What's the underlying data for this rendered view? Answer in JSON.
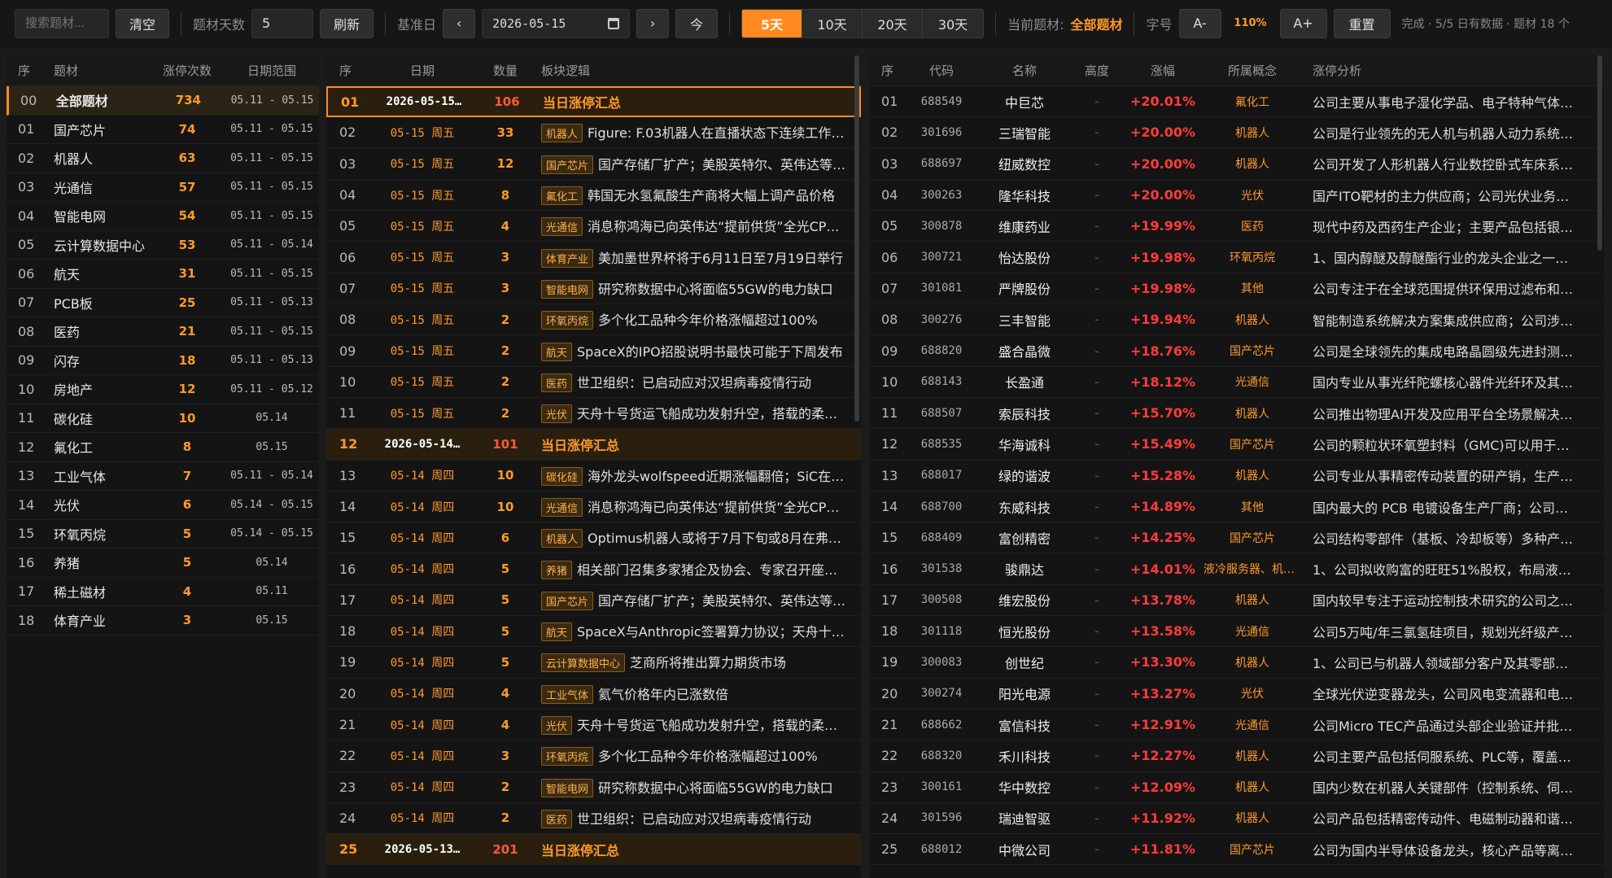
{
  "toolbar": {
    "search_placeholder": "搜索题材...",
    "clear_label": "清空",
    "days_label": "题材天数",
    "days_value": "5",
    "refresh_label": "刷新",
    "base_date_label": "基准日",
    "prev_label": "‹",
    "date_value": "2026-05-15",
    "next_label": "›",
    "today_label": "今",
    "ranges": [
      "5天",
      "10天",
      "20天",
      "30天"
    ],
    "current_topic_label": "当前题材:",
    "current_topic_value": "全部题材",
    "font_label": "字号",
    "font_dec": "A-",
    "font_zoom": "110%",
    "font_inc": "A+",
    "reset_label": "重置",
    "status": "完成 · 5/5 日有数据 · 题材 18 个"
  },
  "topics": {
    "headers": [
      "序",
      "题材",
      "涨停次数",
      "日期范围"
    ],
    "rows": [
      [
        "00",
        "全部题材",
        "734",
        "05.11 - 05.15"
      ],
      [
        "01",
        "国产芯片",
        "74",
        "05.11 - 05.15"
      ],
      [
        "02",
        "机器人",
        "63",
        "05.11 - 05.15"
      ],
      [
        "03",
        "光通信",
        "57",
        "05.11 - 05.15"
      ],
      [
        "04",
        "智能电网",
        "54",
        "05.11 - 05.15"
      ],
      [
        "05",
        "云计算数据中心",
        "53",
        "05.11 - 05.14"
      ],
      [
        "06",
        "航天",
        "31",
        "05.11 - 05.15"
      ],
      [
        "07",
        "PCB板",
        "25",
        "05.11 - 05.13"
      ],
      [
        "08",
        "医药",
        "21",
        "05.11 - 05.15"
      ],
      [
        "09",
        "闪存",
        "18",
        "05.11 - 05.13"
      ],
      [
        "10",
        "房地产",
        "12",
        "05.11 - 05.12"
      ],
      [
        "11",
        "碳化硅",
        "10",
        "05.14"
      ],
      [
        "12",
        "氟化工",
        "8",
        "05.15"
      ],
      [
        "13",
        "工业气体",
        "7",
        "05.11 - 05.14"
      ],
      [
        "14",
        "光伏",
        "6",
        "05.14 - 05.15"
      ],
      [
        "15",
        "环氧丙烷",
        "5",
        "05.14 - 05.15"
      ],
      [
        "16",
        "养猪",
        "5",
        "05.14"
      ],
      [
        "17",
        "稀土磁材",
        "4",
        "05.11"
      ],
      [
        "18",
        "体育产业",
        "3",
        "05.15"
      ]
    ]
  },
  "days": {
    "headers": [
      "序",
      "日期",
      "数量",
      "板块逻辑"
    ],
    "rows": [
      {
        "idx": "01",
        "date": "2026-05-15…",
        "count": "106",
        "tag": "",
        "logic": "当日涨停汇总",
        "sum": true
      },
      {
        "idx": "02",
        "date": "05-15 周五",
        "count": "33",
        "tag": "机器人",
        "logic": "Figure: F.03机器人在直播状态下连续工作超…"
      },
      {
        "idx": "03",
        "date": "05-15 周五",
        "count": "12",
        "tag": "国产芯片",
        "logic": "国产存储厂扩产；美股英特尔、英伟达等股…"
      },
      {
        "idx": "04",
        "date": "05-15 周五",
        "count": "8",
        "tag": "氟化工",
        "logic": "韩国无水氢氟酸生产商将大幅上调产品价格"
      },
      {
        "idx": "05",
        "date": "05-15 周五",
        "count": "4",
        "tag": "光通信",
        "logic": "消息称鸿海已向英伟达“提前供货”全光CPO…"
      },
      {
        "idx": "06",
        "date": "05-15 周五",
        "count": "3",
        "tag": "体育产业",
        "logic": "美加墨世界杯将于6月11日至7月19日举行"
      },
      {
        "idx": "07",
        "date": "05-15 周五",
        "count": "3",
        "tag": "智能电网",
        "logic": "研究称数据中心将面临55GW的电力缺口"
      },
      {
        "idx": "08",
        "date": "05-15 周五",
        "count": "2",
        "tag": "环氧丙烷",
        "logic": "多个化工品种今年价格涨幅超过100%"
      },
      {
        "idx": "09",
        "date": "05-15 周五",
        "count": "2",
        "tag": "航天",
        "logic": "SpaceX的IPO招股说明书最快可能于下周发布"
      },
      {
        "idx": "10",
        "date": "05-15 周五",
        "count": "2",
        "tag": "医药",
        "logic": "世卫组织：已启动应对汉坦病毒疫情行动"
      },
      {
        "idx": "11",
        "date": "05-15 周五",
        "count": "2",
        "tag": "光伏",
        "logic": "天舟十号货运飞船成功发射升空，搭载的柔性封…"
      },
      {
        "idx": "12",
        "date": "2026-05-14…",
        "count": "101",
        "tag": "",
        "logic": "当日涨停汇总",
        "sum": true
      },
      {
        "idx": "13",
        "date": "05-14 周四",
        "count": "10",
        "tag": "碳化硅",
        "logic": "海外龙头wolfspeed近期涨幅翻倍；SiC在Co…"
      },
      {
        "idx": "14",
        "date": "05-14 周四",
        "count": "10",
        "tag": "光通信",
        "logic": "消息称鸿海已向英伟达“提前供货”全光CPO…"
      },
      {
        "idx": "15",
        "date": "05-14 周四",
        "count": "6",
        "tag": "机器人",
        "logic": "Optimus机器人或将于7月下旬或8月在弗里…"
      },
      {
        "idx": "16",
        "date": "05-14 周四",
        "count": "5",
        "tag": "养猪",
        "logic": "相关部门召集多家猪企及协会、专家召开座谈会"
      },
      {
        "idx": "17",
        "date": "05-14 周四",
        "count": "5",
        "tag": "国产芯片",
        "logic": "国产存储厂扩产；美股英特尔、英伟达等股…"
      },
      {
        "idx": "18",
        "date": "05-14 周四",
        "count": "5",
        "tag": "航天",
        "logic": "SpaceX与Anthropic签署算力协议；天舟十号…"
      },
      {
        "idx": "19",
        "date": "05-14 周四",
        "count": "5",
        "tag": "云计算数据中心",
        "logic": "芝商所将推出算力期货市场"
      },
      {
        "idx": "20",
        "date": "05-14 周四",
        "count": "4",
        "tag": "工业气体",
        "logic": "氦气价格年内已涨数倍"
      },
      {
        "idx": "21",
        "date": "05-14 周四",
        "count": "4",
        "tag": "光伏",
        "logic": "天舟十号货运飞船成功发射升空，搭载的柔性封…"
      },
      {
        "idx": "22",
        "date": "05-14 周四",
        "count": "3",
        "tag": "环氧丙烷",
        "logic": "多个化工品种今年价格涨幅超过100%"
      },
      {
        "idx": "23",
        "date": "05-14 周四",
        "count": "2",
        "tag": "智能电网",
        "logic": "研究称数据中心将面临55GW的电力缺口"
      },
      {
        "idx": "24",
        "date": "05-14 周四",
        "count": "2",
        "tag": "医药",
        "logic": "世卫组织：已启动应对汉坦病毒疫情行动"
      },
      {
        "idx": "25",
        "date": "2026-05-13…",
        "count": "201",
        "tag": "",
        "logic": "当日涨停汇总",
        "sum": true
      }
    ]
  },
  "stocks": {
    "headers": [
      "序",
      "代码",
      "名称",
      "高度",
      "涨幅",
      "所属概念",
      "涨停分析"
    ],
    "rows": [
      [
        "01",
        "688549",
        "中巨芯",
        "-",
        "+20.01%",
        "氟化工",
        "公司主要从事电子湿化学品、电子特种气体…"
      ],
      [
        "02",
        "301696",
        "三瑞智能",
        "-",
        "+20.00%",
        "机器人",
        "公司是行业领先的无人机与机器人动力系统…"
      ],
      [
        "03",
        "688697",
        "纽威数控",
        "-",
        "+20.00%",
        "机器人",
        "公司开发了人形机器人行业数控卧式车床系…"
      ],
      [
        "04",
        "300263",
        "隆华科技",
        "-",
        "+20.00%",
        "光伏",
        "国产ITO靶材的主力供应商；公司光伏业务…"
      ],
      [
        "05",
        "300878",
        "维康药业",
        "-",
        "+19.99%",
        "医药",
        "现代中药及西药生产企业；主要产品包括银…"
      ],
      [
        "06",
        "300721",
        "怡达股份",
        "-",
        "+19.98%",
        "环氧丙烷",
        "1、国内醇醚及醇醚酯行业的龙头企业之一…"
      ],
      [
        "07",
        "301081",
        "严牌股份",
        "-",
        "+19.98%",
        "其他",
        "公司专注于在全球范围提供环保用过滤布和…"
      ],
      [
        "08",
        "300276",
        "三丰智能",
        "-",
        "+19.94%",
        "机器人",
        "智能制造系统解决方案集成供应商；公司涉…"
      ],
      [
        "09",
        "688820",
        "盛合晶微",
        "-",
        "+18.76%",
        "国产芯片",
        "公司是全球领先的集成电路晶圆级先进封测…"
      ],
      [
        "10",
        "688143",
        "长盈通",
        "-",
        "+18.12%",
        "光通信",
        "国内专业从事光纤陀螺核心器件光纤环及其…"
      ],
      [
        "11",
        "688507",
        "索辰科技",
        "-",
        "+15.70%",
        "机器人",
        "公司推出物理AI开发及应用平台全场景解决…"
      ],
      [
        "12",
        "688535",
        "华海诚科",
        "-",
        "+15.49%",
        "国产芯片",
        "公司的颗粒状环氧塑封料（GMC)可以用于…"
      ],
      [
        "13",
        "688017",
        "绿的谐波",
        "-",
        "+15.28%",
        "机器人",
        "公司专业从事精密传动装置的研产销，生产…"
      ],
      [
        "14",
        "688700",
        "东威科技",
        "-",
        "+14.89%",
        "其他",
        "国内最大的 PCB 电镀设备生产厂商；公司…"
      ],
      [
        "15",
        "688409",
        "富创精密",
        "-",
        "+14.25%",
        "国产芯片",
        "公司结构零部件（基板、冷却板等）多种产…"
      ],
      [
        "16",
        "301538",
        "骏鼎达",
        "-",
        "+14.01%",
        "液冷服务器、机器人",
        "1、公司拟收购富的旺旺51%股权，布局液…"
      ],
      [
        "17",
        "300508",
        "维宏股份",
        "-",
        "+13.78%",
        "机器人",
        "国内较早专注于运动控制技术研究的公司之…"
      ],
      [
        "18",
        "301118",
        "恒光股份",
        "-",
        "+13.58%",
        "光通信",
        "公司5万吨/年三氯氢硅项目，规划光纤级产…"
      ],
      [
        "19",
        "300083",
        "创世纪",
        "-",
        "+13.30%",
        "机器人",
        "1、公司已与机器人领域部分客户及其零部…"
      ],
      [
        "20",
        "300274",
        "阳光电源",
        "-",
        "+13.27%",
        "光伏",
        "全球光伏逆变器龙头，公司风电变流器和电…"
      ],
      [
        "21",
        "688662",
        "富信科技",
        "-",
        "+12.91%",
        "光通信",
        "公司Micro TEC产品通过头部企业验证并批…"
      ],
      [
        "22",
        "688320",
        "禾川科技",
        "-",
        "+12.27%",
        "机器人",
        "公司主要产品包括伺服系统、PLC等，覆盖…"
      ],
      [
        "23",
        "300161",
        "华中数控",
        "-",
        "+12.09%",
        "机器人",
        "国内少数在机器人关键部件（控制系统、伺…"
      ],
      [
        "24",
        "301596",
        "瑞迪智驱",
        "-",
        "+11.92%",
        "机器人",
        "公司产品包括精密传动件、电磁制动器和谐…"
      ],
      [
        "25",
        "688012",
        "中微公司",
        "-",
        "+11.81%",
        "国产芯片",
        "公司为国内半导体设备龙头，核心产品等离…"
      ]
    ]
  }
}
